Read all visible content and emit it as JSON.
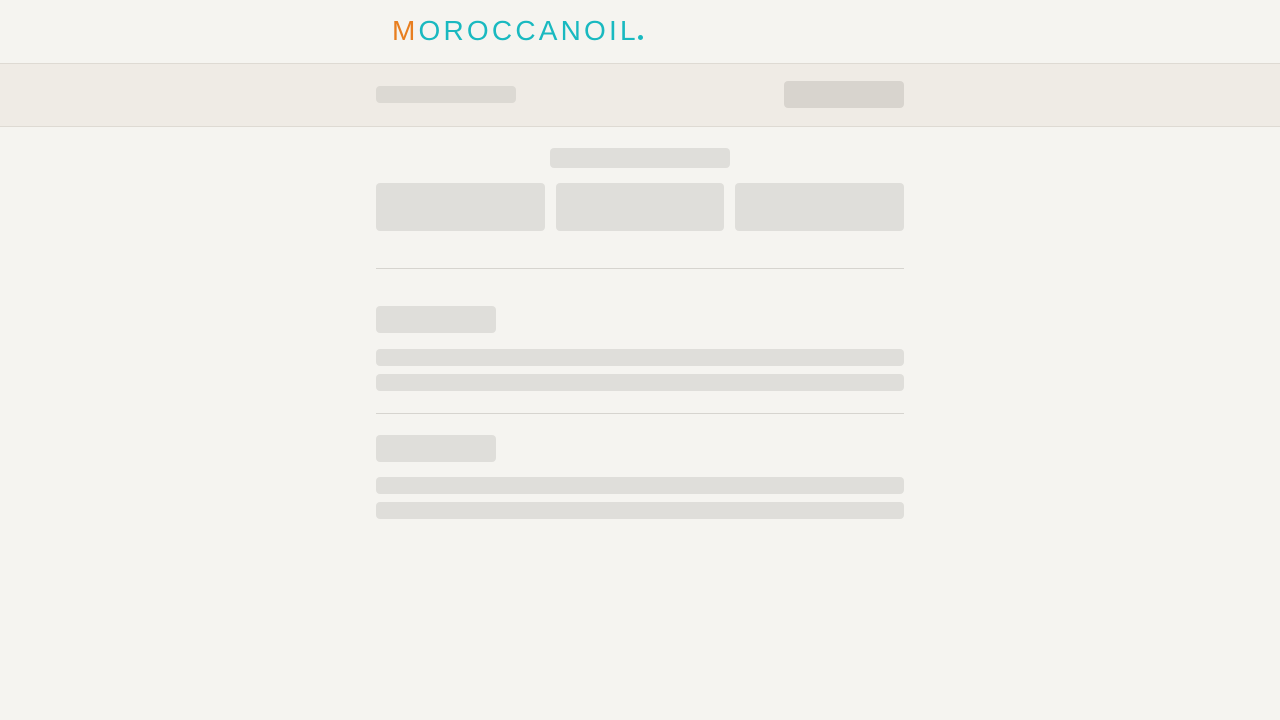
{
  "header": {
    "logo": {
      "first_letter": "M",
      "rest": "OROCCANOIL",
      "first_letter_color": "#e87e1f",
      "brand_color": "#19b9c0"
    }
  },
  "state": "loading",
  "colors": {
    "page_background": "#f5f4f0",
    "summary_bar_background": "#efebe5",
    "skeleton": "#dfdeda",
    "divider": "#d6d4cf"
  }
}
